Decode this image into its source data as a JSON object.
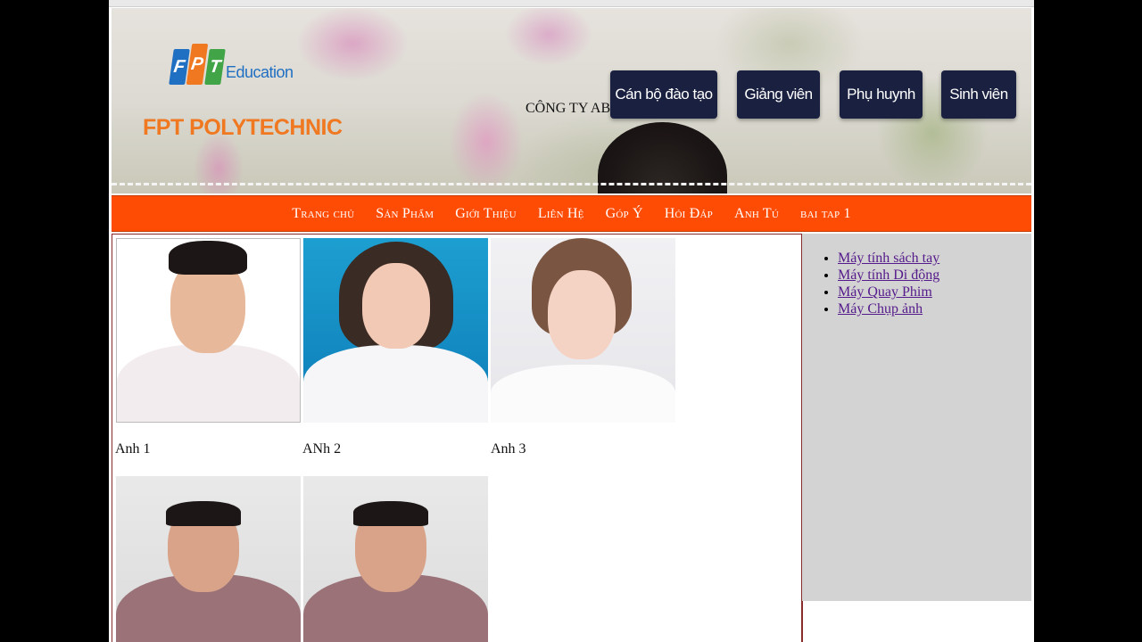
{
  "header": {
    "logo_letters": [
      "F",
      "P",
      "T"
    ],
    "logo_edu": "Education",
    "logo_poly": "FPT POLYTECHNIC",
    "company": "CÔNG TY ABC",
    "roles": [
      "Cán bộ đào tạo",
      "Giảng viên",
      "Phụ huynh",
      "Sinh viên"
    ]
  },
  "nav": [
    "Trang chủ",
    "Sản Phẩm",
    "Giới Thiệu",
    "Liên Hệ",
    "Góp Ý",
    "Hỏi Đáp",
    "Anh Tú",
    "bai tap 1"
  ],
  "gallery": {
    "captions": [
      "Anh 1",
      "ANh 2",
      "Anh 3"
    ]
  },
  "sidebar": {
    "links": [
      "Máy tính sách tay",
      "Máy tính Di động",
      "Máy Quay Phim",
      "Máy Chụp ảnh"
    ]
  },
  "colors": {
    "nav_bg": "#ff4c05",
    "role_btn_bg": "#1a2040",
    "sidebar_bg": "#d3d3d3",
    "link": "#551a8b"
  }
}
